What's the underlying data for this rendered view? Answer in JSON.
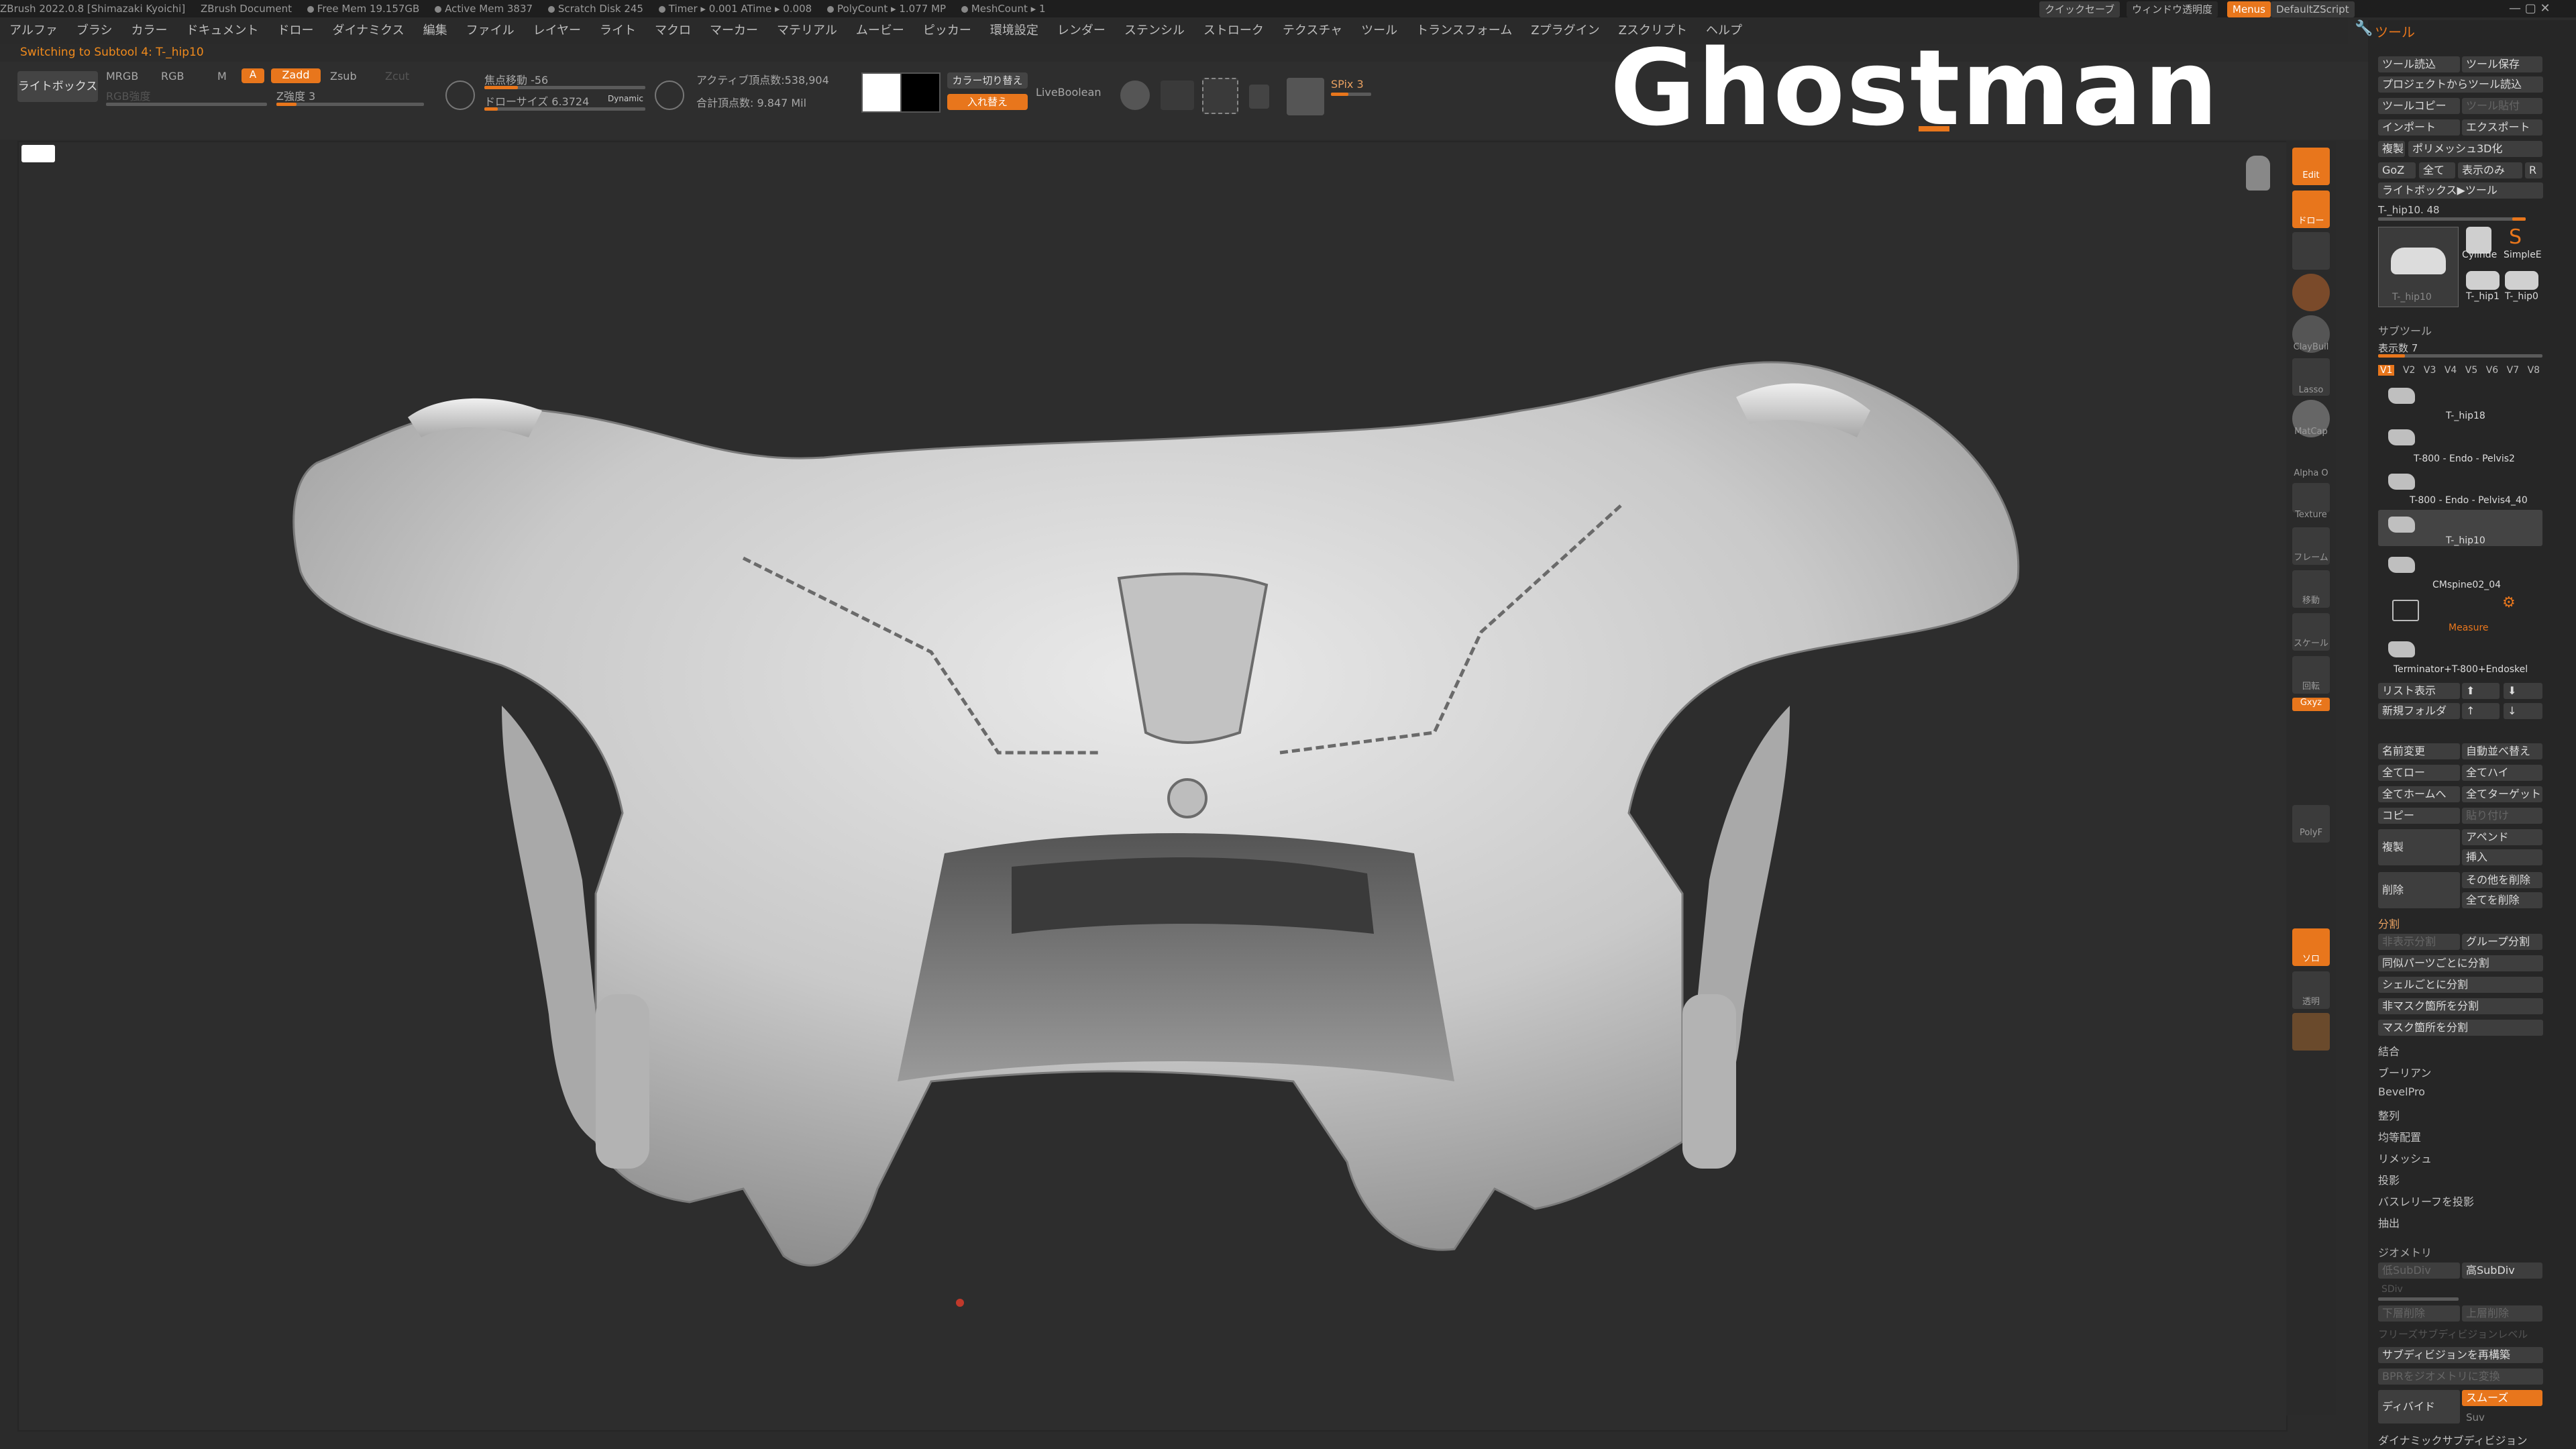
{
  "titlebar": {
    "app": "ZBrush 2022.0.8 [Shimazaki Kyoichi]",
    "doc": "ZBrush Document",
    "free_mem": "Free Mem 19.157GB",
    "active_mem": "Active Mem 3837",
    "scratch": "Scratch Disk 245",
    "timer": "Timer ▸ 0.001 ATime ▸ 0.008",
    "polycount": "PolyCount ▸ 1.077 MP",
    "meshcount": "MeshCount ▸ 1",
    "quicksave": "クイックセーブ",
    "window_trans": "ウィンドウ透明度",
    "menus": "Menus",
    "zscript": "DefaultZScript"
  },
  "menubar": [
    "アルファ",
    "ブラシ",
    "カラー",
    "ドキュメント",
    "ドロー",
    "ダイナミクス",
    "編集",
    "ファイル",
    "レイヤー",
    "ライト",
    "マクロ",
    "マーカー",
    "マテリアル",
    "ムービー",
    "ピッカー",
    "環境設定",
    "レンダー",
    "ステンシル",
    "ストローク",
    "テクスチャ",
    "ツール",
    "トランスフォーム",
    "Zプラグイン",
    "Zスクリプト",
    "ヘルプ"
  ],
  "status": {
    "switching": "Switching to Subtool 4: T-_hip10"
  },
  "toolbar": {
    "lightbox": "ライトボックス",
    "mrgb": "MRGB",
    "rgb": "RGB",
    "m": "M",
    "a": "A",
    "zadd": "Zadd",
    "zsub": "Zsub",
    "zcut": "Zcut",
    "rgb_intensity": "RGB強度",
    "z_intensity": "Z強度 3",
    "focal_shift": "焦点移動 -56",
    "draw_size": "ドローサイズ 6.3724",
    "dynamic": "Dynamic",
    "active_points": "アクティブ頂点数:538,904",
    "total_points": "合計頂点数: 9.847 Mil",
    "color_switch": "カラー切り替え",
    "swap": "入れ替え",
    "liveboolean": "LiveBoolean",
    "spix": "SPix 3"
  },
  "overlay": {
    "title": "Ghostman"
  },
  "shelf": {
    "edit": "Edit",
    "draw": "ドロー",
    "claybuild": "ClayBuil",
    "lasso": "Lasso",
    "matcap": "MatCap",
    "alpha": "Alpha O",
    "texture": "Texture",
    "frame": "フレーム",
    "move": "移動",
    "scale": "スケール",
    "rotate": "回転",
    "xyz": "Gxyz",
    "polyf": "PolyF",
    "solo": "ソロ",
    "transp": "透明"
  },
  "tool": {
    "header": "ツール",
    "load": "ツール読込",
    "save": "ツール保存",
    "from_project": "プロジェクトからツール読込",
    "copy": "ツールコピー",
    "paste": "ツール貼付",
    "import": "インポート",
    "export": "エクスポート",
    "clone": "複製",
    "make_polymesh": "ポリメッシュ3D化",
    "goz": "GoZ",
    "all": "全て",
    "visible": "表示のみ",
    "r": "R",
    "lightbox_tool": "ライトボックス▶ツール",
    "current": "T-_hip10. 48",
    "thumb_current": "T-_hip10",
    "thumb_cyl": "Cylinde",
    "thumb_simple": "SimpleE",
    "thumb_a": "T-_hip1",
    "thumb_b": "T-_hip0",
    "subtool_header": "サブツール",
    "visible_count": "表示数 7",
    "versions": [
      "V1",
      "V2",
      "V3",
      "V4",
      "V5",
      "V6",
      "V7",
      "V8"
    ],
    "subtools": [
      "T-_hip18",
      "T-800 - Endo - Pelvis2",
      "T-800 - Endo - Pelvis4_40",
      "T-_hip10",
      "CMspine02_04",
      "Measure",
      "Terminator+T-800+Endoskel"
    ],
    "list_view": "リスト表示",
    "new_folder": "新規フォルダ",
    "rename": "名前変更",
    "autosort": "自動並べ替え",
    "all_low": "全てロー",
    "all_high": "全てハイ",
    "all_home": "全てホームへ",
    "all_target": "全てターゲット",
    "copy2": "コピー",
    "paste2": "貼り付け",
    "duplicate": "複製",
    "append": "アペンド",
    "insert": "挿入",
    "delete": "削除",
    "delete_other": "その他を削除",
    "delete_all": "全てを削除",
    "split": "分割",
    "split_hidden": "非表示分割",
    "groups_split": "グループ分割",
    "split_similar": "同似パーツごとに分割",
    "split_shell": "シェルごとに分割",
    "split_unmasked": "非マスク箇所を分割",
    "split_masked": "マスク箇所を分割",
    "merge": "結合",
    "boolean": "ブーリアン",
    "bevelpro": "BevelPro",
    "align": "整列",
    "distribute": "均等配置",
    "remesh": "リメッシュ",
    "project": "投影",
    "project_bas": "バスレリーフを投影",
    "extract": "抽出",
    "geometry": "ジオメトリ",
    "lower_res": "低SubDiv",
    "higher_res": "高SubDiv",
    "sdiv": "SDiv",
    "del_lower": "下層削除",
    "del_higher": "上層削除",
    "freeze_subd": "フリーズサブディビジョンレベル",
    "reconstruct": "サブディビジョンを再構築",
    "convert_bpr": "BPRをジオメトリに変換",
    "divide": "ディバイド",
    "smooth": "スムーズ",
    "suv": "Suv",
    "dynamic_subdiv": "ダイナミックサブディビジョン"
  },
  "colors": {
    "accent": "#e8761c",
    "bg": "#2d2d2d",
    "panel": "#262626"
  }
}
